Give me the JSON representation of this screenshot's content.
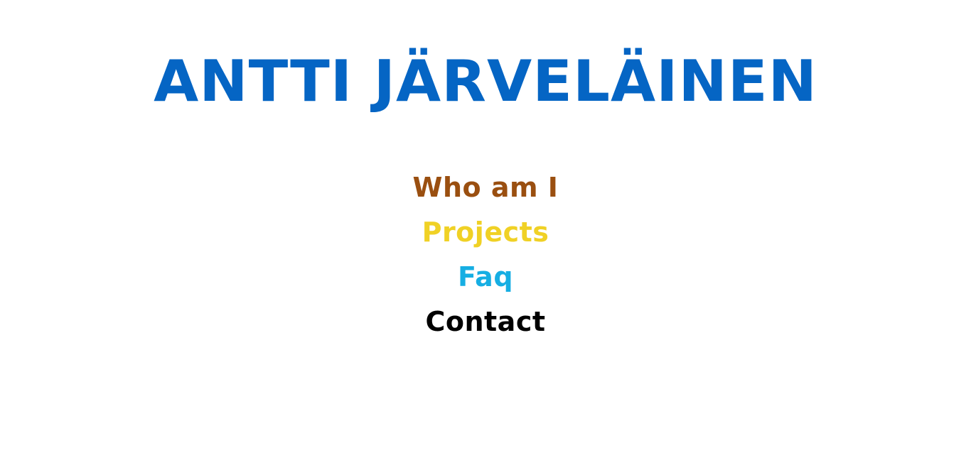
{
  "header": {
    "title": "ANTTI JÄRVELÄINEN",
    "title_color": "#0565c4"
  },
  "nav": {
    "items": [
      {
        "label": "Who am I",
        "color": "#9a4f10"
      },
      {
        "label": "Projects",
        "color": "#f0d125"
      },
      {
        "label": "Faq",
        "color": "#16aee3"
      },
      {
        "label": "Contact",
        "color": "#000000"
      }
    ]
  }
}
